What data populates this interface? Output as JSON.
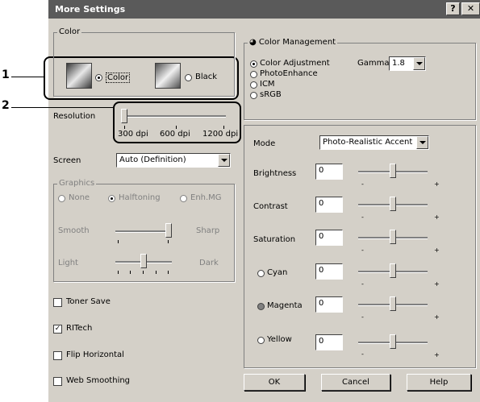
{
  "window": {
    "title": "More Settings",
    "help_glyph": "?",
    "close_glyph": "✕"
  },
  "callouts": {
    "one": "1",
    "two": "2"
  },
  "color": {
    "legend": "Color",
    "options": [
      {
        "label": "Color",
        "selected": true,
        "icon": "color-printer-icon"
      },
      {
        "label": "Black",
        "selected": false,
        "icon": "black-printer-icon"
      }
    ]
  },
  "resolution": {
    "label": "Resolution",
    "ticks": [
      "300 dpi",
      "600 dpi",
      "1200 dpi"
    ],
    "selected_index": 0
  },
  "screen": {
    "label": "Screen",
    "value": "Auto (Definition)"
  },
  "graphics": {
    "legend": "Graphics",
    "enabled": false,
    "options": [
      {
        "label": "None",
        "selected": false
      },
      {
        "label": "Halftoning",
        "selected": true
      },
      {
        "label": "Enh.MG",
        "selected": false
      }
    ],
    "smooth_label": "Smooth",
    "sharp_label": "Sharp",
    "light_label": "Light",
    "dark_label": "Dark"
  },
  "checkboxes": [
    {
      "label": "Toner Save",
      "checked": false
    },
    {
      "label": "RITech",
      "checked": true
    },
    {
      "label": "Flip Horizontal",
      "checked": false
    },
    {
      "label": "Web Smoothing",
      "checked": false
    }
  ],
  "color_management": {
    "legend": "Color Management",
    "icon": "palette-icon",
    "options": [
      {
        "label": "Color Adjustment",
        "selected": true
      },
      {
        "label": "PhotoEnhance",
        "selected": false
      },
      {
        "label": "ICM",
        "selected": false
      },
      {
        "label": "sRGB",
        "selected": false
      }
    ],
    "gamma_label": "Gamma",
    "gamma_value": "1.8"
  },
  "adjust": {
    "mode_label": "Mode",
    "mode_value": "Photo-Realistic Accent",
    "minus": "-",
    "plus": "+",
    "rows": [
      {
        "label": "Brightness",
        "value": "0"
      },
      {
        "label": "Contrast",
        "value": "0"
      },
      {
        "label": "Saturation",
        "value": "0"
      },
      {
        "label": "Cyan",
        "value": "0",
        "dot": "#ffffff"
      },
      {
        "label": "Magenta",
        "value": "0",
        "dot": "#808080"
      },
      {
        "label": "Yellow",
        "value": "0",
        "dot": "#ffffff"
      }
    ]
  },
  "buttons": {
    "ok": "OK",
    "cancel": "Cancel",
    "help": "Help"
  }
}
